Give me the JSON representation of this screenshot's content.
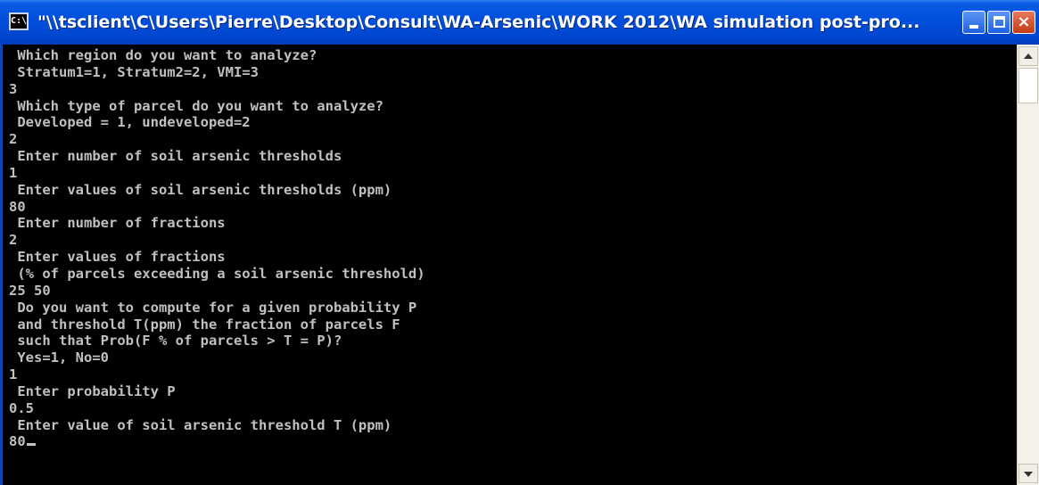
{
  "window": {
    "title": "\"\\\\tsclient\\C\\Users\\Pierre\\Desktop\\Consult\\WA-Arsenic\\WORK 2012\\WA simulation post-pro...",
    "icon_label": "C:\\",
    "app_icon": "console-icon",
    "buttons": {
      "minimize": "minimize-icon",
      "maximize": "maximize-icon",
      "close": "×"
    }
  },
  "console": {
    "lines": [
      " Which region do you want to analyze?",
      " Stratum1=1, Stratum2=2, VMI=3",
      "3",
      " Which type of parcel do you want to analyze?",
      " Developed = 1, undeveloped=2",
      "2",
      " Enter number of soil arsenic thresholds",
      "1",
      " Enter values of soil arsenic thresholds (ppm)",
      "80",
      " Enter number of fractions",
      "2",
      " Enter values of fractions",
      " (% of parcels exceeding a soil arsenic threshold)",
      "25 50",
      " Do you want to compute for a given probability P",
      " and threshold T(ppm) the fraction of parcels F",
      " such that Prob(F % of parcels > T = P)?",
      " Yes=1, No=0",
      "1",
      " Enter probability P",
      "0.5",
      " Enter value of soil arsenic threshold T (ppm)"
    ],
    "input_line": "80"
  },
  "scrollbar": {
    "up_icon": "arrow-up-icon",
    "down_icon": "arrow-down-icon"
  },
  "colors": {
    "titlebar": "#0050dd",
    "console_bg": "#000000",
    "console_text": "#c0c0c0",
    "close_button": "#c63b12"
  }
}
